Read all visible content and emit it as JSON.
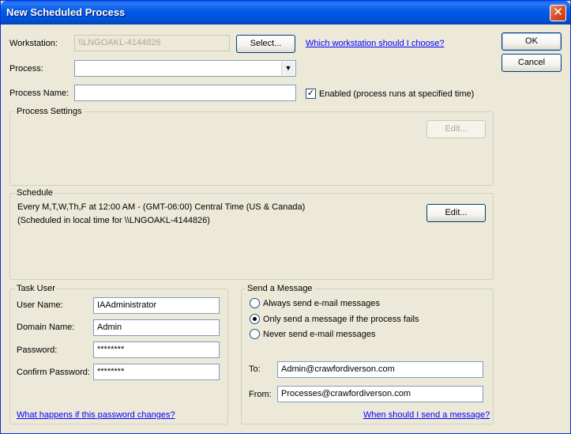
{
  "window": {
    "title": "New Scheduled Process",
    "close_glyph": "✕"
  },
  "workstation": {
    "label": "Workstation:",
    "value": "\\\\LNGOAKL-4144826",
    "select_button": "Select...",
    "help_link": "Which workstation should I choose?"
  },
  "process": {
    "label": "Process:",
    "value": ""
  },
  "process_name": {
    "label": "Process Name:",
    "value": ""
  },
  "enabled": {
    "label": "Enabled (process runs at specified time)",
    "checked": true,
    "glyph": "✓"
  },
  "buttons": {
    "ok": "OK",
    "cancel": "Cancel"
  },
  "process_settings": {
    "title": "Process Settings",
    "edit_button": "Edit..."
  },
  "schedule": {
    "title": "Schedule",
    "line1": "Every M,T,W,Th,F at 12:00 AM - (GMT-06:00) Central Time (US & Canada)",
    "line2": "(Scheduled in local time for \\\\LNGOAKL-4144826)",
    "edit_button": "Edit..."
  },
  "task_user": {
    "title": "Task User",
    "user_name_label": "User Name:",
    "user_name_value": "IAAdministrator",
    "domain_label": "Domain Name:",
    "domain_value": "Admin",
    "password_label": "Password:",
    "password_value": "********",
    "confirm_label": "Confirm Password:",
    "confirm_value": "********",
    "help_link": "What happens if this password changes?"
  },
  "send_message": {
    "title": "Send a Message",
    "options": [
      {
        "label": "Always send e-mail messages",
        "selected": false
      },
      {
        "label": "Only send a message if the process fails",
        "selected": true
      },
      {
        "label": "Never send e-mail messages",
        "selected": false
      }
    ],
    "to_label": "To:",
    "to_value": "Admin@crawfordiverson.com",
    "from_label": "From:",
    "from_value": "Processes@crawfordiverson.com",
    "help_link": "When should I send a message?"
  },
  "icons": {
    "close": "close-icon",
    "dropdown": "chevron-down-icon",
    "check": "checkmark-icon"
  }
}
